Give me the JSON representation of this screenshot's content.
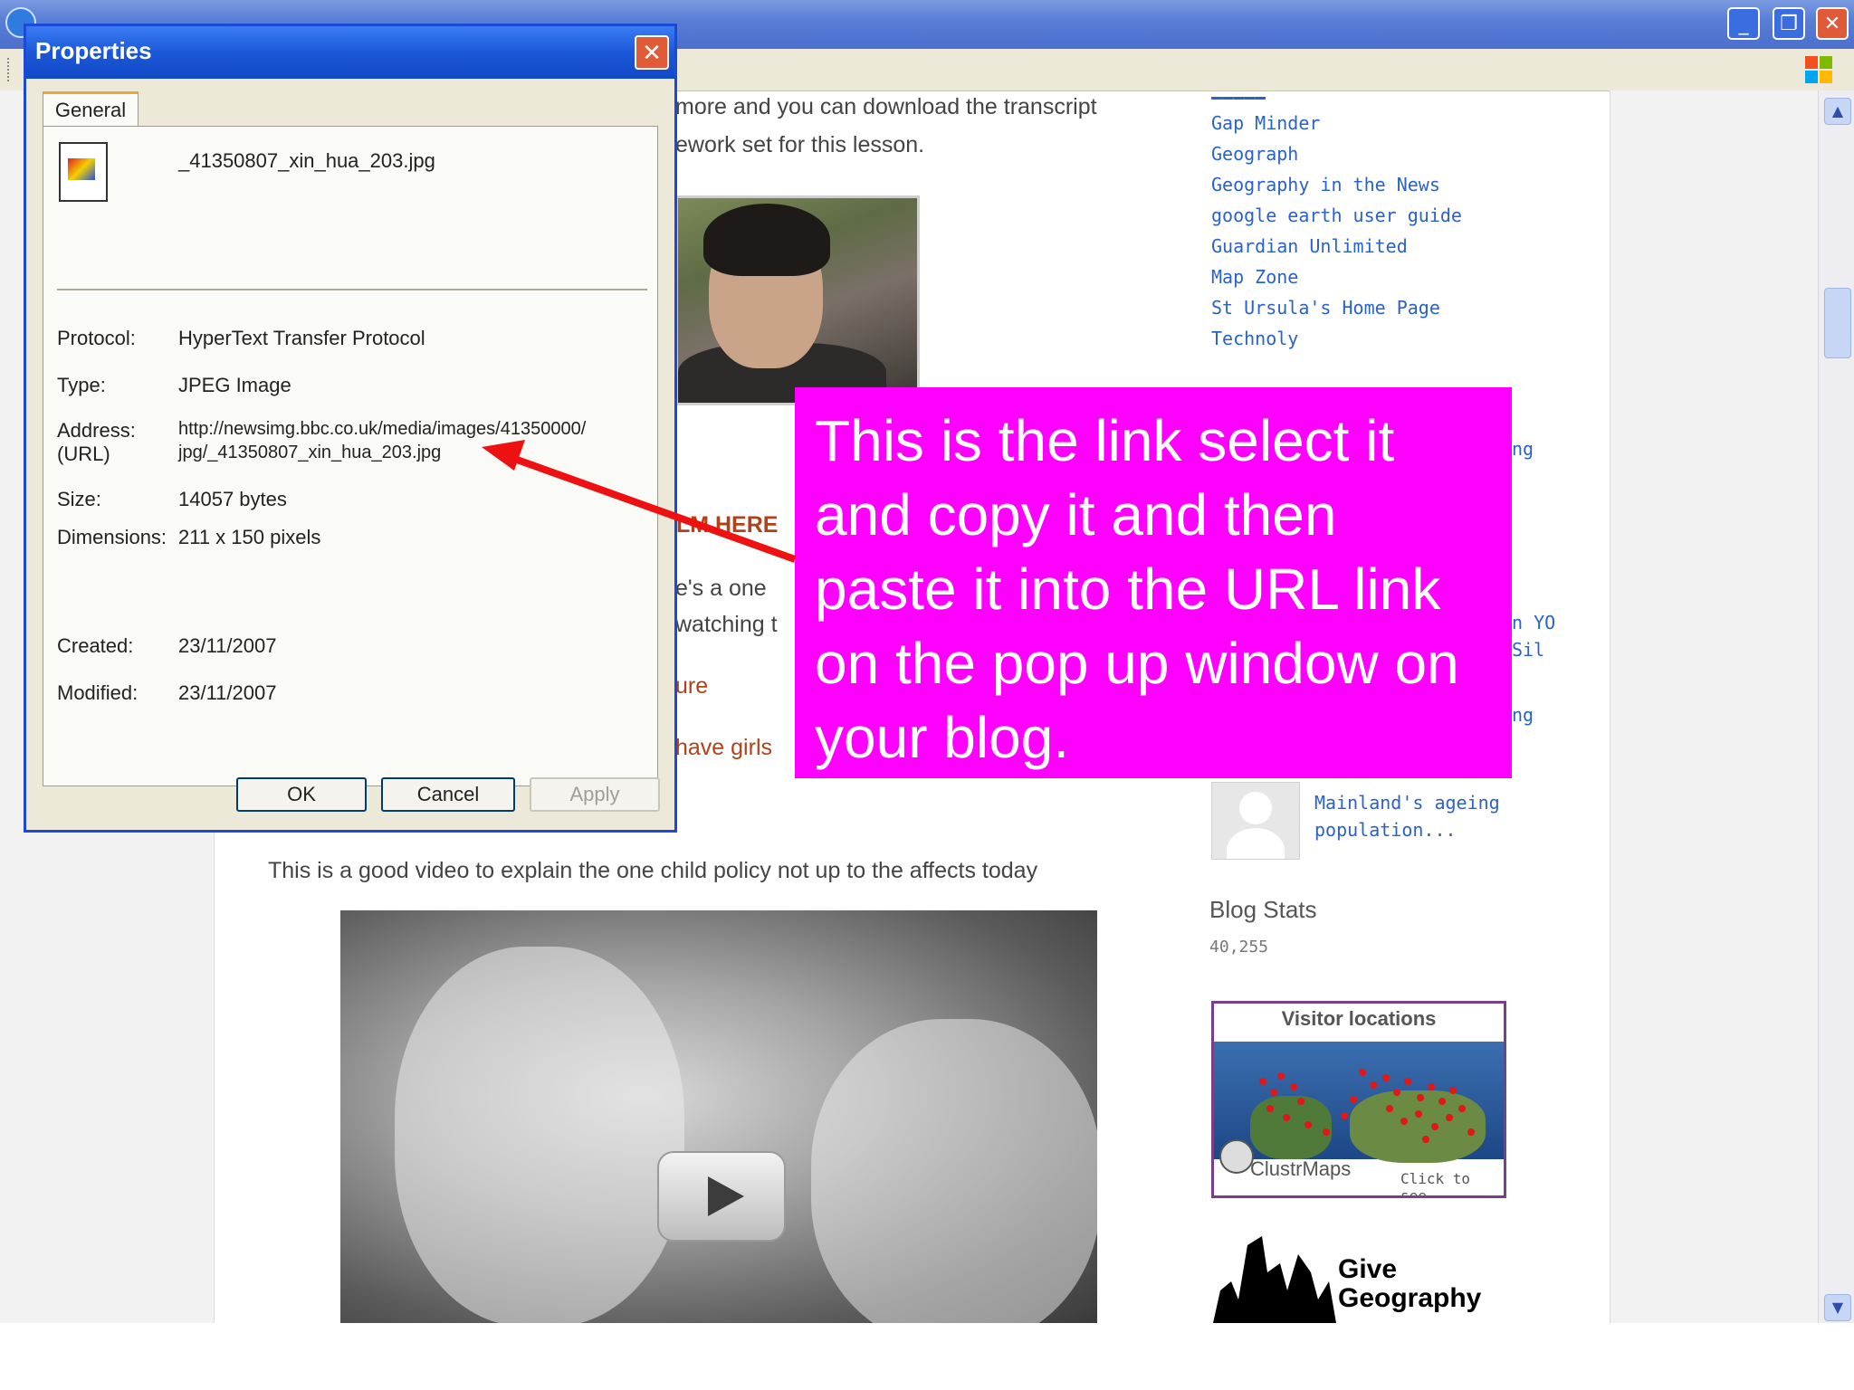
{
  "browser": {
    "title": "",
    "minimize": "_",
    "restore": "❐",
    "close": "✕"
  },
  "article": {
    "line1": "more and you can download the transcript",
    "line2": "ework set for this lesson.",
    "film_here": "ILM HERE",
    "snippet1": "e's a one",
    "snippet2": "watching t",
    "snippet3": "ure",
    "snippet4": "have girls",
    "video_caption": "This is a good video to explain the one child policy not up to the affects today"
  },
  "sidebar": {
    "links": [
      "Gap Minder",
      "Geograph",
      "Geography in the News",
      "google earth user guide",
      "Guardian Unlimited",
      "Map Zone",
      "St Ursula's Home Page",
      "Technoly"
    ],
    "peek1": "ng",
    "peek2": "n YO",
    "peek3": "Sil",
    "peek4": "ng",
    "recent_post": "Mainland's ageing population...",
    "blog_stats_title": "Blog Stats",
    "blog_stats_value": "40,255",
    "clustrmaps_title": "Visitor locations",
    "clustrmaps_brand": "ClustrMaps",
    "clustrmaps_click": "Click to see",
    "give_geo_1": "Give",
    "give_geo_2": "Geography"
  },
  "dialog": {
    "title": "Properties",
    "tab": "General",
    "filename": "_41350807_xin_hua_203.jpg",
    "rows": [
      {
        "label": "Protocol:",
        "value": "HyperText Transfer Protocol"
      },
      {
        "label": "Type:",
        "value": "JPEG Image"
      },
      {
        "label": "Address:",
        "value": "http://newsimg.bbc.co.uk/media/images/41350000/"
      },
      {
        "label": "(URL)",
        "value": "jpg/_41350807_xin_hua_203.jpg"
      },
      {
        "label": "Size:",
        "value": "14057 bytes"
      },
      {
        "label": "Dimensions:",
        "value": "211 x 150 pixels"
      },
      {
        "label": "Created:",
        "value": "23/11/2007"
      },
      {
        "label": "Modified:",
        "value": "23/11/2007"
      }
    ],
    "ok": "OK",
    "cancel": "Cancel",
    "apply": "Apply"
  },
  "callout": {
    "text": "This is the link select it and copy it and then paste it into the URL link on the pop up window on your blog."
  },
  "colors": {
    "callout_bg": "#ff00ff",
    "arrow": "#ee1111",
    "link_blue": "#2a62c9",
    "xp_blue": "#1a4ad6"
  }
}
